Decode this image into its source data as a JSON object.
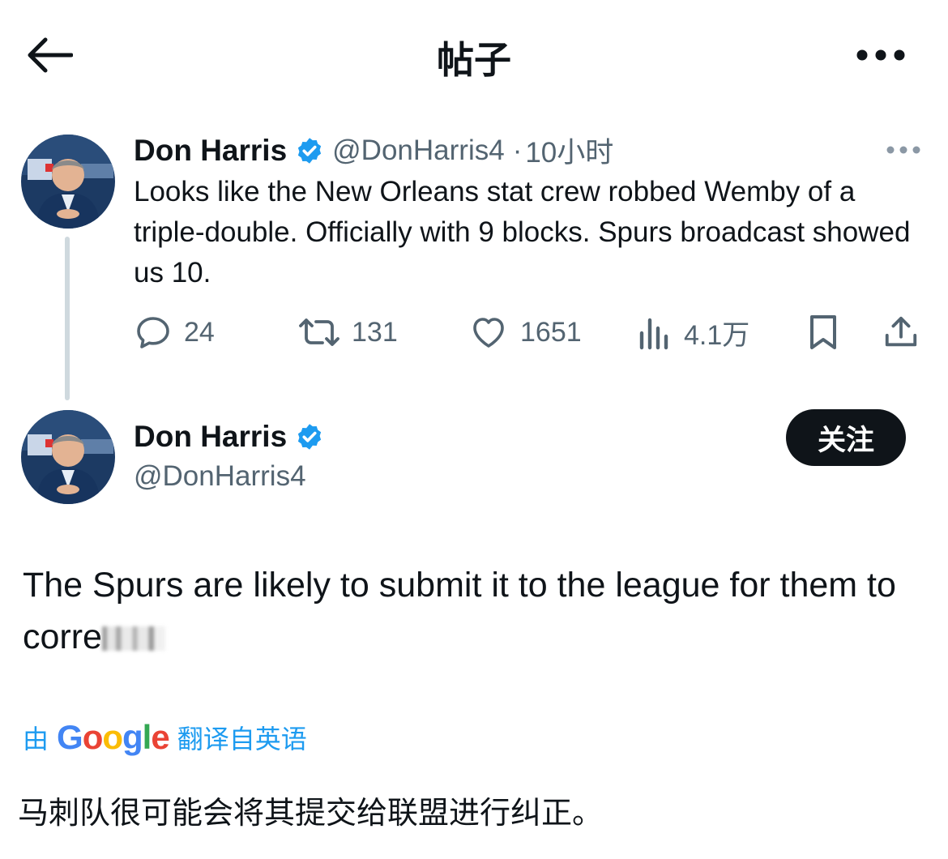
{
  "header": {
    "title": "帖子",
    "back_icon": "arrow-left-icon",
    "more_icon": "more-horizontal-icon"
  },
  "parent_tweet": {
    "name": "Don Harris",
    "handle": "@DonHarris4",
    "separator": "·",
    "time": "10小时",
    "verified_color": "#1d9bf0",
    "text": "Looks like the New Orleans stat crew robbed Wemby of a triple-double. Officially with 9 blocks. Spurs broadcast showed us 10.",
    "actions": {
      "replies": "24",
      "retweets": "131",
      "likes": "1651",
      "views": "4.1万"
    }
  },
  "main_tweet": {
    "name": "Don Harris",
    "handle": "@DonHarris4",
    "follow_label": "关注",
    "text": "The Spurs are likely to submit it to the league for them to corre",
    "text_tail_blurred": "ct it."
  },
  "translation": {
    "prefix": "由",
    "brand": [
      "G",
      "o",
      "o",
      "g",
      "l",
      "e"
    ],
    "brand_colors": [
      "#4285f4",
      "#ea4335",
      "#fbbc05",
      "#4285f4",
      "#34a853",
      "#ea4335"
    ],
    "suffix": "翻译自英语",
    "text": "马刺队很可能会将其提交给联盟进行纠正。"
  }
}
